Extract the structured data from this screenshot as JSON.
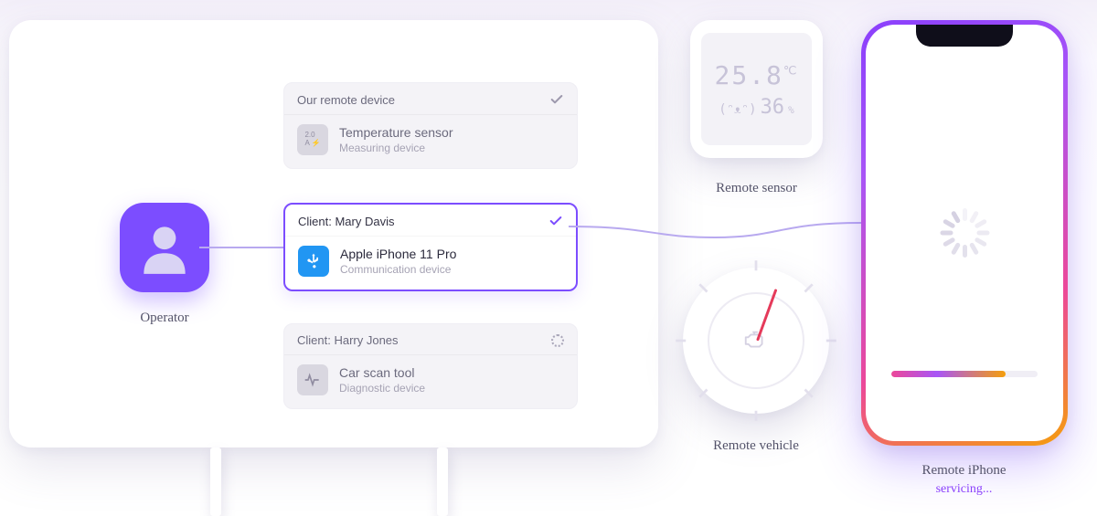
{
  "operator": {
    "label": "Operator"
  },
  "devices": [
    {
      "header": "Our remote device",
      "name": "Temperature sensor",
      "subtitle": "Measuring device",
      "icon_label": "2.0\nA ⚡",
      "status": "check",
      "active": false
    },
    {
      "header": "Client: Mary Davis",
      "name": "Apple iPhone 11 Pro",
      "subtitle": "Communication device",
      "icon_label": "usb",
      "status": "check",
      "active": true
    },
    {
      "header": "Client: Harry Jones",
      "name": "Car scan tool",
      "subtitle": "Diagnostic device",
      "icon_label": "ecg",
      "status": "loading",
      "active": false
    }
  ],
  "sensor": {
    "label": "Remote sensor",
    "temperature": "25.8",
    "temp_unit": "℃",
    "humidity": "36",
    "humidity_unit": "%",
    "face": "(ᵔᴥᵔ)"
  },
  "vehicle": {
    "label": "Remote vehicle"
  },
  "phone": {
    "label": "Remote iPhone",
    "status": "servicing...",
    "progress_percent": 78
  },
  "colors": {
    "accent": "#7c4dff",
    "gradient_start": "#8a3ffc",
    "gradient_mid": "#ec4899",
    "gradient_end": "#f59e0b"
  }
}
